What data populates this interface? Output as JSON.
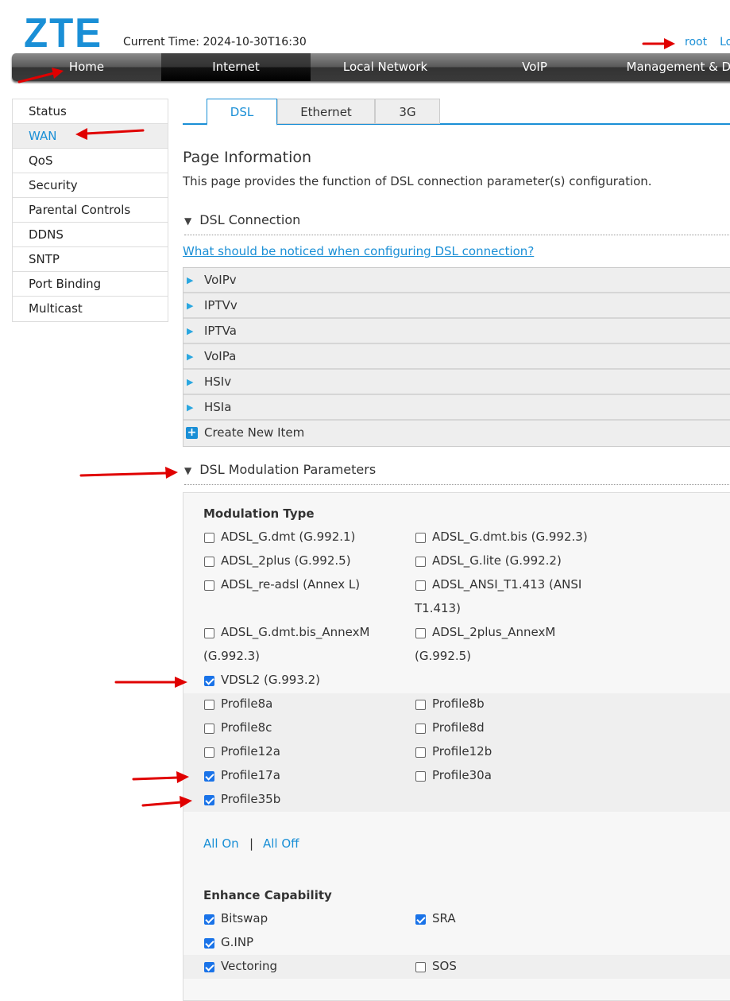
{
  "header": {
    "logo": "ZTE",
    "current_time": "Current Time: 2024-10-30T16:30",
    "user": "root",
    "logout": "Lo"
  },
  "nav": [
    {
      "label": "Home"
    },
    {
      "label": "Internet",
      "active": true
    },
    {
      "label": "Local Network"
    },
    {
      "label": "VoIP"
    },
    {
      "label": "Management & Dia"
    }
  ],
  "sidebar": [
    {
      "label": "Status"
    },
    {
      "label": "WAN",
      "active": true
    },
    {
      "label": "QoS"
    },
    {
      "label": "Security"
    },
    {
      "label": "Parental Controls"
    },
    {
      "label": "DDNS"
    },
    {
      "label": "SNTP"
    },
    {
      "label": "Port Binding"
    },
    {
      "label": "Multicast"
    }
  ],
  "tabs": [
    {
      "label": "DSL",
      "active": true
    },
    {
      "label": "Ethernet"
    },
    {
      "label": "3G"
    }
  ],
  "page_info": {
    "title": "Page Information",
    "desc": "This page provides the function of DSL connection parameter(s) configuration."
  },
  "dsl_connection": {
    "title": "DSL Connection",
    "help_link": "What should be noticed when configuring DSL connection?",
    "items": [
      "VoIPv",
      "IPTVv",
      "IPTVa",
      "VoIPa",
      "HSIv",
      "HSIa"
    ],
    "create": "Create New Item"
  },
  "modulation": {
    "title": "DSL Modulation Parameters",
    "type_label": "Modulation Type",
    "options": [
      {
        "label": "ADSL_G.dmt (G.992.1)",
        "checked": false
      },
      {
        "label": "ADSL_G.dmt.bis (G.992.3)",
        "checked": false
      },
      {
        "label": "ADSL_2plus (G.992.5)",
        "checked": false
      },
      {
        "label": "ADSL_G.lite (G.992.2)",
        "checked": false
      },
      {
        "label": "ADSL_re-adsl (Annex L)",
        "checked": false
      },
      {
        "label": "ADSL_ANSI_T1.413 (ANSI",
        "label2": "T1.413)",
        "checked": false
      },
      {
        "label": "ADSL_G.dmt.bis_AnnexM",
        "label2": "(G.992.3)",
        "checked": false
      },
      {
        "label": "ADSL_2plus_AnnexM",
        "label2": "(G.992.5)",
        "checked": false
      },
      {
        "label": "VDSL2 (G.993.2)",
        "checked": true
      }
    ],
    "profiles": [
      {
        "label": "Profile8a",
        "checked": false
      },
      {
        "label": "Profile8b",
        "checked": false
      },
      {
        "label": "Profile8c",
        "checked": false
      },
      {
        "label": "Profile8d",
        "checked": false
      },
      {
        "label": "Profile12a",
        "checked": false
      },
      {
        "label": "Profile12b",
        "checked": false
      },
      {
        "label": "Profile17a",
        "checked": true
      },
      {
        "label": "Profile30a",
        "checked": false
      },
      {
        "label": "Profile35b",
        "checked": true
      }
    ],
    "all_on": "All On",
    "sep": "|",
    "all_off": "All Off",
    "enhance_label": "Enhance Capability",
    "enhance": [
      {
        "label": "Bitswap",
        "checked": true
      },
      {
        "label": "SRA",
        "checked": true
      },
      {
        "label": "G.INP",
        "checked": true
      },
      {
        "label": "Vectoring",
        "checked": true
      },
      {
        "label": "SOS",
        "checked": false
      }
    ]
  },
  "colors": {
    "accent": "#1a8fd6",
    "checkbox": "#1a73e8",
    "annotation": "#e00000"
  }
}
